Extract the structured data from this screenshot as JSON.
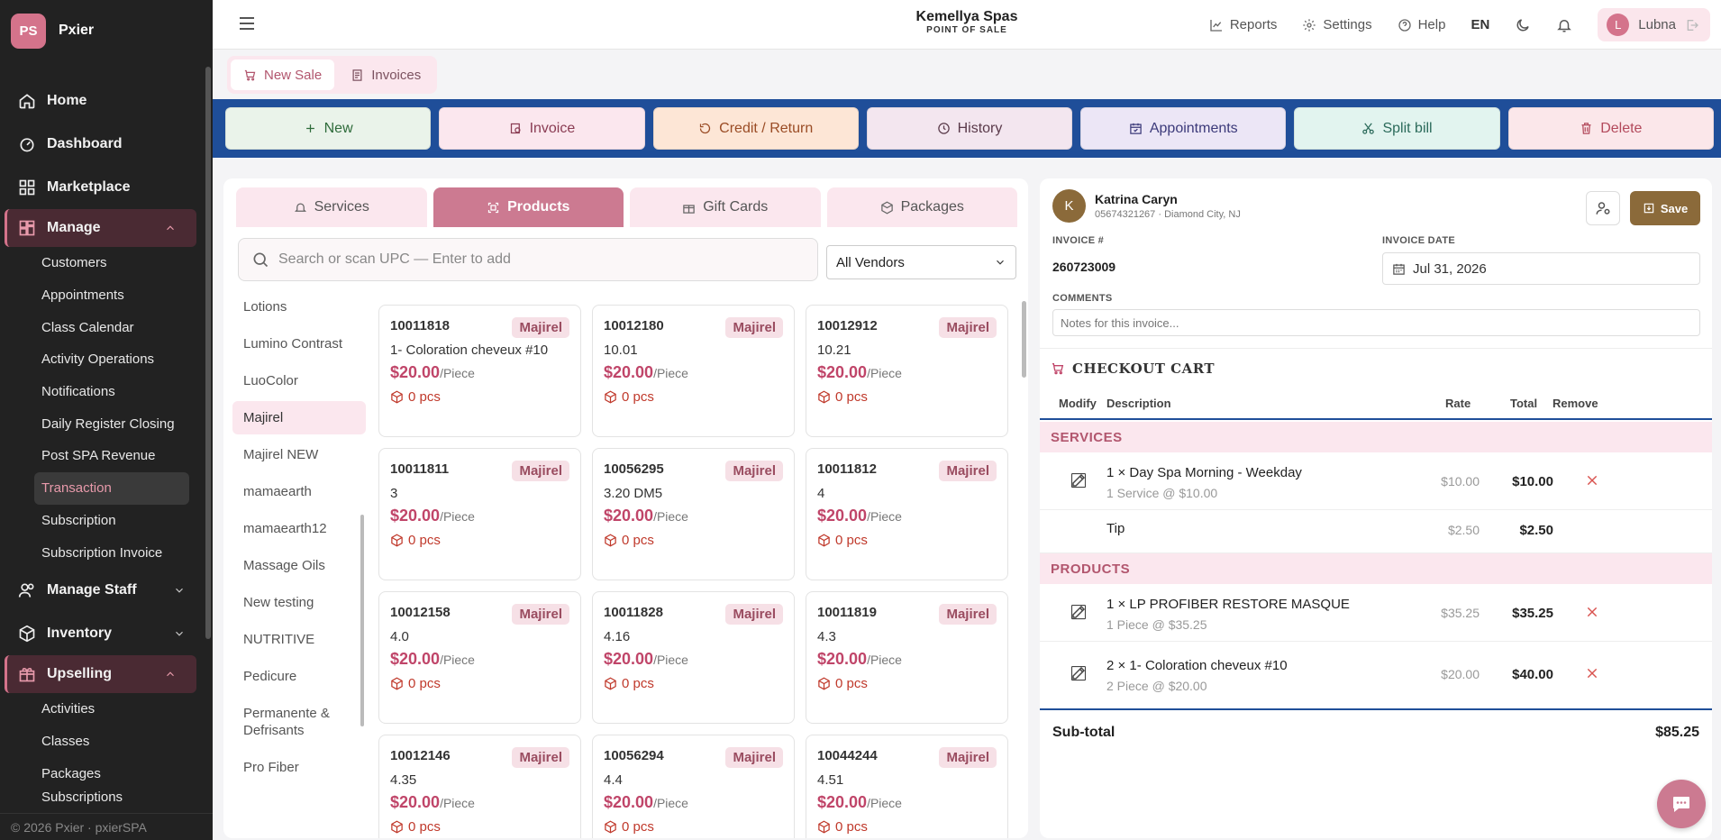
{
  "app": {
    "logo_initials": "PS",
    "name": "Pxier",
    "footer": "© 2026 Pxier · pxierSPA"
  },
  "sidebar": {
    "top_items": [
      {
        "label": "Home",
        "icon": "home-icon"
      },
      {
        "label": "Dashboard",
        "icon": "dashboard-icon"
      },
      {
        "label": "Marketplace",
        "icon": "marketplace-icon"
      }
    ],
    "manage": {
      "label": "Manage",
      "items": [
        "Customers",
        "Appointments",
        "Class Calendar",
        "Activity Operations",
        "Notifications",
        "Daily Register Closing",
        "Post SPA Revenue",
        "Transaction",
        "Subscription",
        "Subscription Invoice"
      ],
      "active": "Transaction"
    },
    "manage_staff": "Manage Staff",
    "inventory": "Inventory",
    "upselling": {
      "label": "Upselling",
      "items": [
        "Activities",
        "Classes",
        "Packages",
        "Subscriptions"
      ]
    }
  },
  "topbar": {
    "store_name": "Kemellya Spas",
    "store_subtitle": "POINT OF SALE",
    "reports": "Reports",
    "settings": "Settings",
    "help": "Help",
    "language": "EN",
    "user_initial": "L",
    "user_name": "Lubna"
  },
  "sale_tabs": {
    "new_sale": "New Sale",
    "invoices": "Invoices"
  },
  "actions": [
    {
      "label": "New",
      "bg": "#eaf3ea",
      "color": "#2e6b3a"
    },
    {
      "label": "Invoice",
      "bg": "#fbe7ee",
      "color": "#8a3c53"
    },
    {
      "label": "Credit / Return",
      "bg": "#fde6d6",
      "color": "#9a4c25"
    },
    {
      "label": "History",
      "bg": "#f3e6ef",
      "color": "#5a3a4a"
    },
    {
      "label": "Appointments",
      "bg": "#ece6f6",
      "color": "#3c3a7a"
    },
    {
      "label": "Split bill",
      "bg": "#e2f4ef",
      "color": "#2b6a5a"
    },
    {
      "label": "Delete",
      "bg": "#fbe7ea",
      "color": "#b34a5c"
    }
  ],
  "catalog_tabs": [
    "Services",
    "Products",
    "Gift Cards",
    "Packages"
  ],
  "search": {
    "placeholder": "Search or scan UPC — Enter to add"
  },
  "vendor_filter": "All Vendors",
  "brands": [
    "Lotions",
    "Lumino Contrast",
    "LuoColor",
    "Majirel",
    "Majirel NEW",
    "mamaearth",
    "mamaearth12",
    "Massage Oils",
    "New testing",
    "NUTRITIVE",
    "Pedicure",
    "Permanente & Defrisants",
    "Pro Fiber"
  ],
  "active_brand": "Majirel",
  "products": [
    {
      "code": "10011818",
      "vendor": "Majirel",
      "name": "1- Coloration cheveux #10",
      "price": "$20.00",
      "unit": "/Piece",
      "stock": "0 pcs"
    },
    {
      "code": "10012180",
      "vendor": "Majirel",
      "name": "10.01",
      "price": "$20.00",
      "unit": "/Piece",
      "stock": "0 pcs"
    },
    {
      "code": "10012912",
      "vendor": "Majirel",
      "name": "10.21",
      "price": "$20.00",
      "unit": "/Piece",
      "stock": "0 pcs"
    },
    {
      "code": "10011811",
      "vendor": "Majirel",
      "name": "3",
      "price": "$20.00",
      "unit": "/Piece",
      "stock": "0 pcs"
    },
    {
      "code": "10056295",
      "vendor": "Majirel",
      "name": "3.20 DM5",
      "price": "$20.00",
      "unit": "/Piece",
      "stock": "0 pcs"
    },
    {
      "code": "10011812",
      "vendor": "Majirel",
      "name": "4",
      "price": "$20.00",
      "unit": "/Piece",
      "stock": "0 pcs"
    },
    {
      "code": "10012158",
      "vendor": "Majirel",
      "name": "4.0",
      "price": "$20.00",
      "unit": "/Piece",
      "stock": "0 pcs"
    },
    {
      "code": "10011828",
      "vendor": "Majirel",
      "name": "4.16",
      "price": "$20.00",
      "unit": "/Piece",
      "stock": "0 pcs"
    },
    {
      "code": "10011819",
      "vendor": "Majirel",
      "name": "4.3",
      "price": "$20.00",
      "unit": "/Piece",
      "stock": "0 pcs"
    },
    {
      "code": "10012146",
      "vendor": "Majirel",
      "name": "4.35",
      "price": "$20.00",
      "unit": "/Piece",
      "stock": "0 pcs"
    },
    {
      "code": "10056294",
      "vendor": "Majirel",
      "name": "4.4",
      "price": "$20.00",
      "unit": "/Piece",
      "stock": "0 pcs"
    },
    {
      "code": "10044244",
      "vendor": "Majirel",
      "name": "4.51",
      "price": "$20.00",
      "unit": "/Piece",
      "stock": "0 pcs"
    }
  ],
  "customer": {
    "initial": "K",
    "name": "Katrina Caryn",
    "info": "05674321267 · Diamond City, NJ"
  },
  "save_label": "Save",
  "invoice": {
    "number_label": "INVOICE #",
    "number": "260723009",
    "date_label": "INVOICE DATE",
    "date": "Jul 31, 2026",
    "comments_label": "COMMENTS",
    "comments_placeholder": "Notes for this invoice..."
  },
  "cart": {
    "title": "CHECKOUT CART",
    "headers": {
      "modify": "Modify",
      "description": "Description",
      "rate": "Rate",
      "total": "Total",
      "remove": "Remove"
    },
    "services_label": "SERVICES",
    "services": [
      {
        "desc": "1 × Day Spa Morning - Weekday",
        "sub": "1 Service @ $10.00",
        "rate": "$10.00",
        "total": "$10.00"
      }
    ],
    "tip": {
      "label": "Tip",
      "rate": "$2.50",
      "total": "$2.50"
    },
    "products_label": "PRODUCTS",
    "products": [
      {
        "desc": "1 × LP PROFIBER RESTORE MASQUE",
        "sub": "1 Piece @ $35.25",
        "rate": "$35.25",
        "total": "$35.25"
      },
      {
        "desc": "2 × 1- Coloration cheveux #10",
        "sub": "2 Piece @ $20.00",
        "rate": "$20.00",
        "total": "$40.00"
      }
    ],
    "subtotal_label": "Sub-total",
    "subtotal": "$85.25"
  }
}
